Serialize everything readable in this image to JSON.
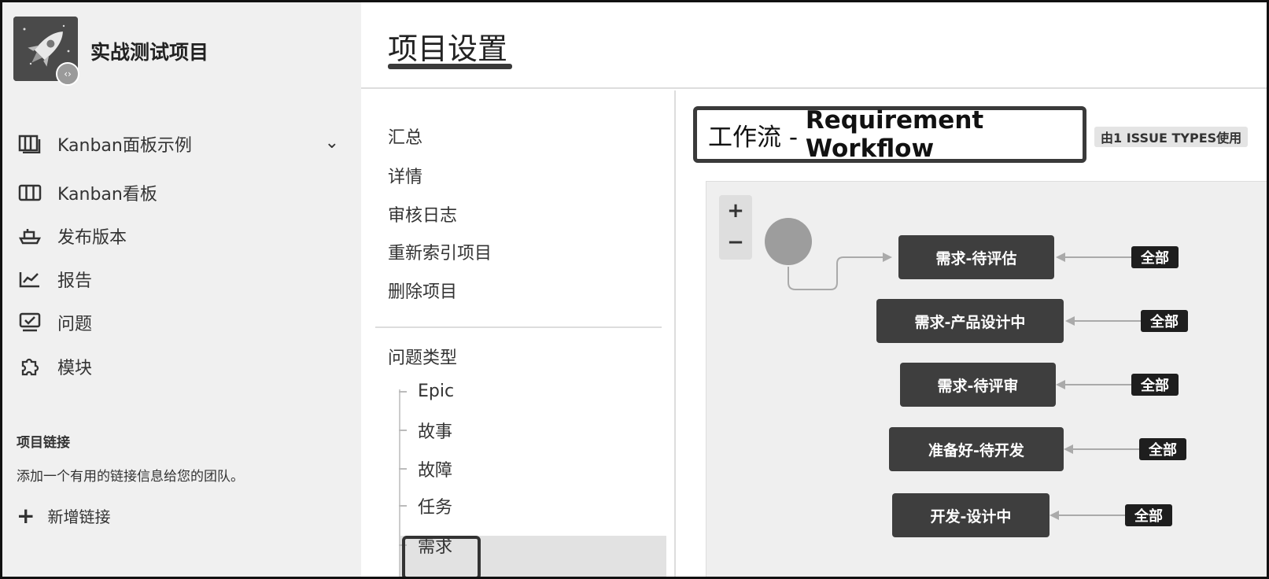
{
  "sidebar": {
    "project_name": "实战测试项目",
    "nav": [
      {
        "label": "Kanban面板示例",
        "icon": "board-icon",
        "expandable": true
      },
      {
        "label": "Kanban看板",
        "icon": "columns-icon"
      },
      {
        "label": "发布版本",
        "icon": "ship-icon"
      },
      {
        "label": "报告",
        "icon": "chart-icon"
      },
      {
        "label": "问题",
        "icon": "issue-icon"
      },
      {
        "label": "模块",
        "icon": "puzzle-icon"
      }
    ],
    "links_title": "项目链接",
    "links_desc": "添加一个有用的链接信息给您的团队。",
    "add_link": "新增链接"
  },
  "header": {
    "title": "项目设置"
  },
  "settings_nav": {
    "items": [
      "汇总",
      "详情",
      "审核日志",
      "重新索引项目",
      "删除项目"
    ],
    "issue_types_label": "问题类型",
    "issue_types": [
      "Epic",
      "故事",
      "故障",
      "任务",
      "需求"
    ],
    "selected_issue_type": "需求"
  },
  "workflow": {
    "title_prefix": "工作流 - ",
    "title_name": "Requirement Workflow",
    "usage_badge": "由1 ISSUE TYPES使用",
    "zoom_in": "+",
    "zoom_out": "−",
    "statuses": [
      {
        "name": "需求-待评估",
        "transition": "全部"
      },
      {
        "name": "需求-产品设计中",
        "transition": "全部"
      },
      {
        "name": "需求-待评审",
        "transition": "全部"
      },
      {
        "name": "准备好-待开发",
        "transition": "全部"
      },
      {
        "name": "开发-设计中",
        "transition": "全部"
      }
    ]
  },
  "colors": {
    "sidebar_bg": "#f0f0f0",
    "node_bg": "#3e3e3e",
    "canvas_bg": "#efefef",
    "highlight_border": "#3a3a3a"
  }
}
